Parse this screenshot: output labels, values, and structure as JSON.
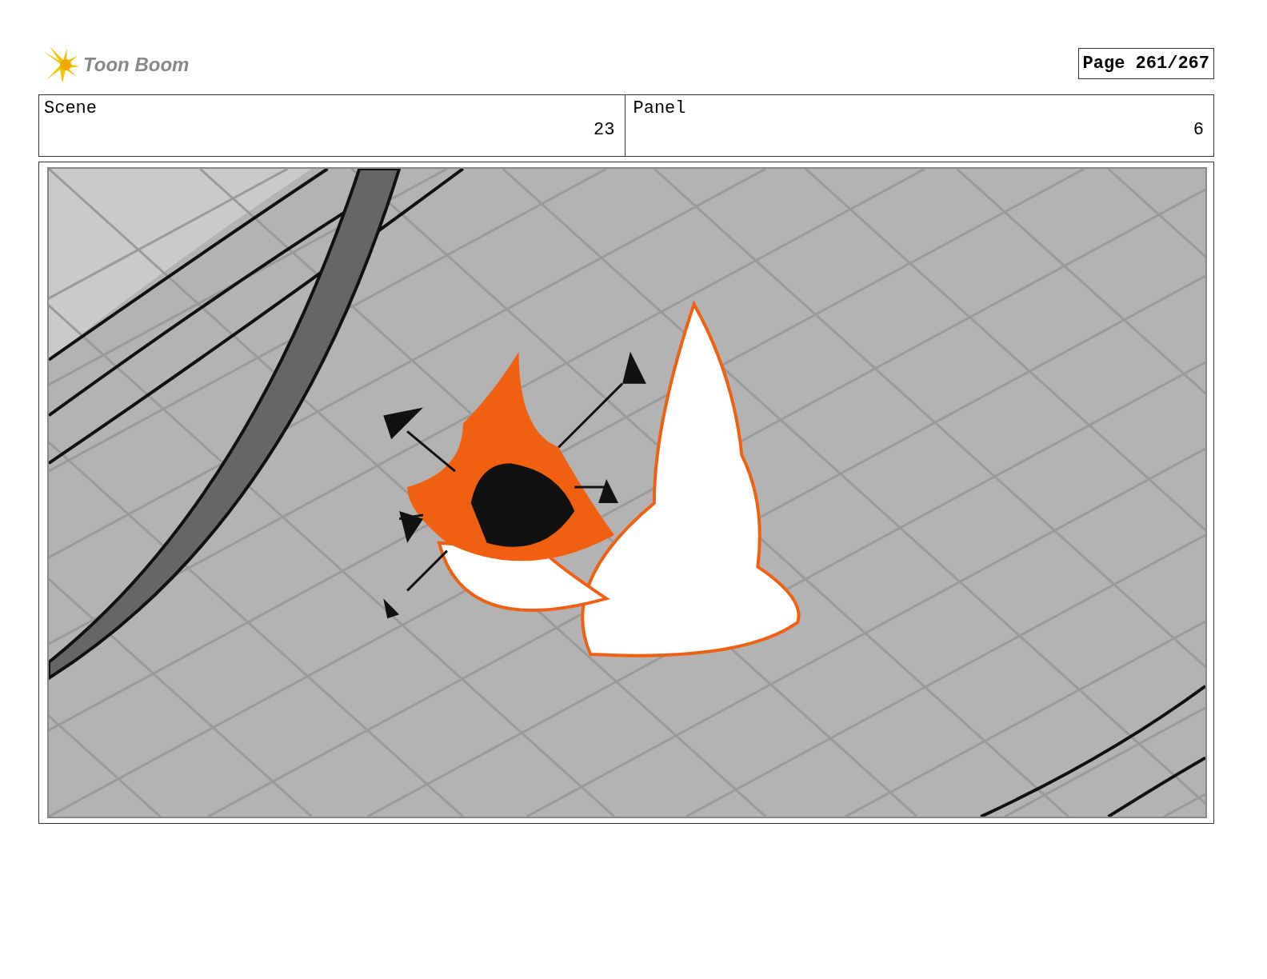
{
  "header": {
    "logo_text": "Toon Boom",
    "page": "Page 261/267"
  },
  "info": [
    {
      "label": "Scene",
      "value": "23"
    },
    {
      "label": "Panel",
      "value": "6"
    }
  ]
}
